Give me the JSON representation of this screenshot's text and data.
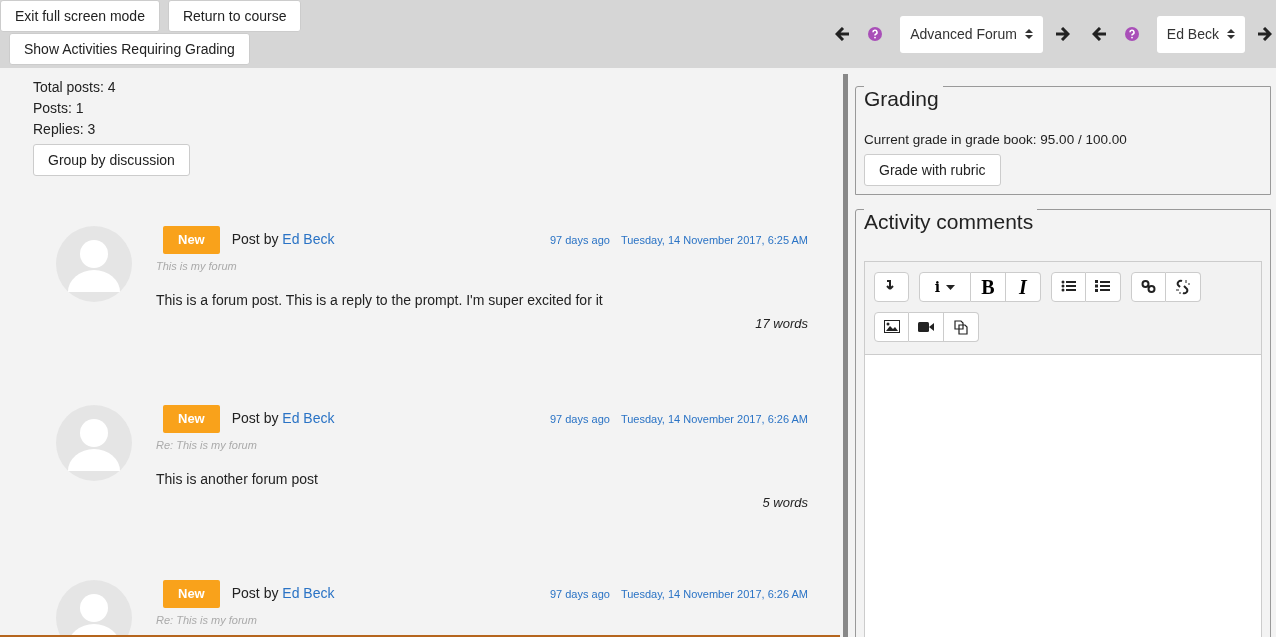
{
  "top_buttons": [
    {
      "label": "Exit full screen mode"
    },
    {
      "label": "Return to course"
    },
    {
      "label": "Show Activities Requiring Grading"
    }
  ],
  "selectors": [
    {
      "value": "Advanced Forum"
    },
    {
      "value": "Ed Beck"
    }
  ],
  "stats": [
    "Total posts: 4",
    "Posts: 1",
    "Replies: 3"
  ],
  "group_button": "Group by discussion",
  "posts": [
    {
      "badge": "New",
      "prefix": "Post by",
      "author": "Ed Beck",
      "ago": "97 days ago",
      "date": "Tuesday, 14 November 2017, 6:25 AM",
      "subject": "This is my forum",
      "body": "This is a forum post. This is a reply to the prompt. I'm super excited for it",
      "words": "17 words"
    },
    {
      "badge": "New",
      "prefix": "Post by",
      "author": "Ed Beck",
      "ago": "97 days ago",
      "date": "Tuesday, 14 November 2017, 6:26 AM",
      "subject": "Re: This is my forum",
      "body": "This is another forum post",
      "words": "5 words"
    },
    {
      "badge": "New",
      "prefix": "Post by",
      "author": "Ed Beck",
      "ago": "97 days ago",
      "date": "Tuesday, 14 November 2017, 6:26 AM",
      "subject": "Re: This is my forum"
    }
  ],
  "grading": {
    "title": "Grading",
    "current": "Current grade in grade book: 95.00 / 100.00",
    "button": "Grade with rubric"
  },
  "comments": {
    "title": "Activity comments",
    "toolbar_rows": [
      [
        [
          {
            "kind": "collapse"
          }
        ],
        [
          {
            "kind": "style",
            "label": "i"
          },
          {
            "kind": "bold",
            "label": "B"
          },
          {
            "kind": "italic",
            "label": "I"
          }
        ],
        [
          {
            "kind": "bullets"
          },
          {
            "kind": "numbers"
          }
        ],
        [
          {
            "kind": "link"
          },
          {
            "kind": "unlink"
          }
        ]
      ],
      [
        [
          {
            "kind": "image"
          },
          {
            "kind": "video"
          },
          {
            "kind": "files"
          }
        ]
      ]
    ]
  }
}
